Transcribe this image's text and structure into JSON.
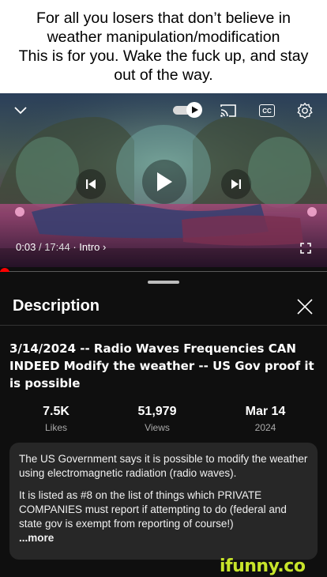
{
  "caption": {
    "lines": [
      "For all you losers that don’t believe in",
      "weather manipulation/modification",
      "This is for you. Wake the fuck up, and stay",
      "out of the way."
    ]
  },
  "player": {
    "icons": {
      "collapse": "chevron-down-icon",
      "autoplay": "autoplay-toggle-icon",
      "cast": "cast-icon",
      "captions": "captions-icon",
      "settings": "gear-icon",
      "previous": "skip-previous-icon",
      "play": "play-icon",
      "next": "skip-next-icon",
      "fullscreen": "fullscreen-icon"
    },
    "captions_label": "CC",
    "time_current": "0:03",
    "time_separator": "/",
    "time_total": "17:44",
    "chapter": "· Intro",
    "chapter_chevron": "›",
    "progress_fraction": 0.003
  },
  "sheet": {
    "title": "Description",
    "video_title": "3/14/2024 -- Radio Waves Frequencies CAN INDEED Modify the weather -- US Gov proof it is possible",
    "stats": [
      {
        "value": "7.5K",
        "label": "Likes"
      },
      {
        "value": "51,979",
        "label": "Views"
      },
      {
        "value": "Mar 14",
        "label": "2024"
      }
    ],
    "description": {
      "p1": "The US Government says it is possible to modify the weather using electromagnetic radiation (radio waves).",
      "p2": "It is listed as #8 on the list of things which PRIVATE COMPANIES must report if attempting to do (federal and state gov is exempt from reporting of course!)",
      "more": "...more"
    }
  },
  "watermark": "ifunny.co",
  "colors": {
    "accent": "#ff0000",
    "sheet_bg": "#0f0f0f",
    "desc_box_bg": "#272727",
    "watermark": "#c7e42a"
  }
}
